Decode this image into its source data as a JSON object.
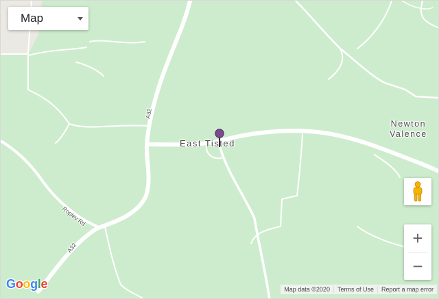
{
  "map_type": {
    "label": "Map"
  },
  "places": {
    "east_tisted": "East Tisted",
    "newton_line1": "Newton",
    "newton_line2": "Valence"
  },
  "roads": {
    "a32_north": "A32",
    "ropley": "Ropley Rd",
    "a32_south": "A32"
  },
  "logo": {
    "text": "Google"
  },
  "attribution": {
    "data": "Map data ©2020",
    "terms": "Terms of Use",
    "report": "Report a map error"
  },
  "zoom": {
    "in": "+",
    "out": "−"
  },
  "colors": {
    "land": "#cdeccd",
    "road": "#ffffff",
    "urban": "#ebe9e3",
    "pin": "#7b4a8e"
  },
  "icons": {
    "pin": "location-pin-icon",
    "pegman": "pegman-icon",
    "dropdown": "caret-down-icon"
  }
}
